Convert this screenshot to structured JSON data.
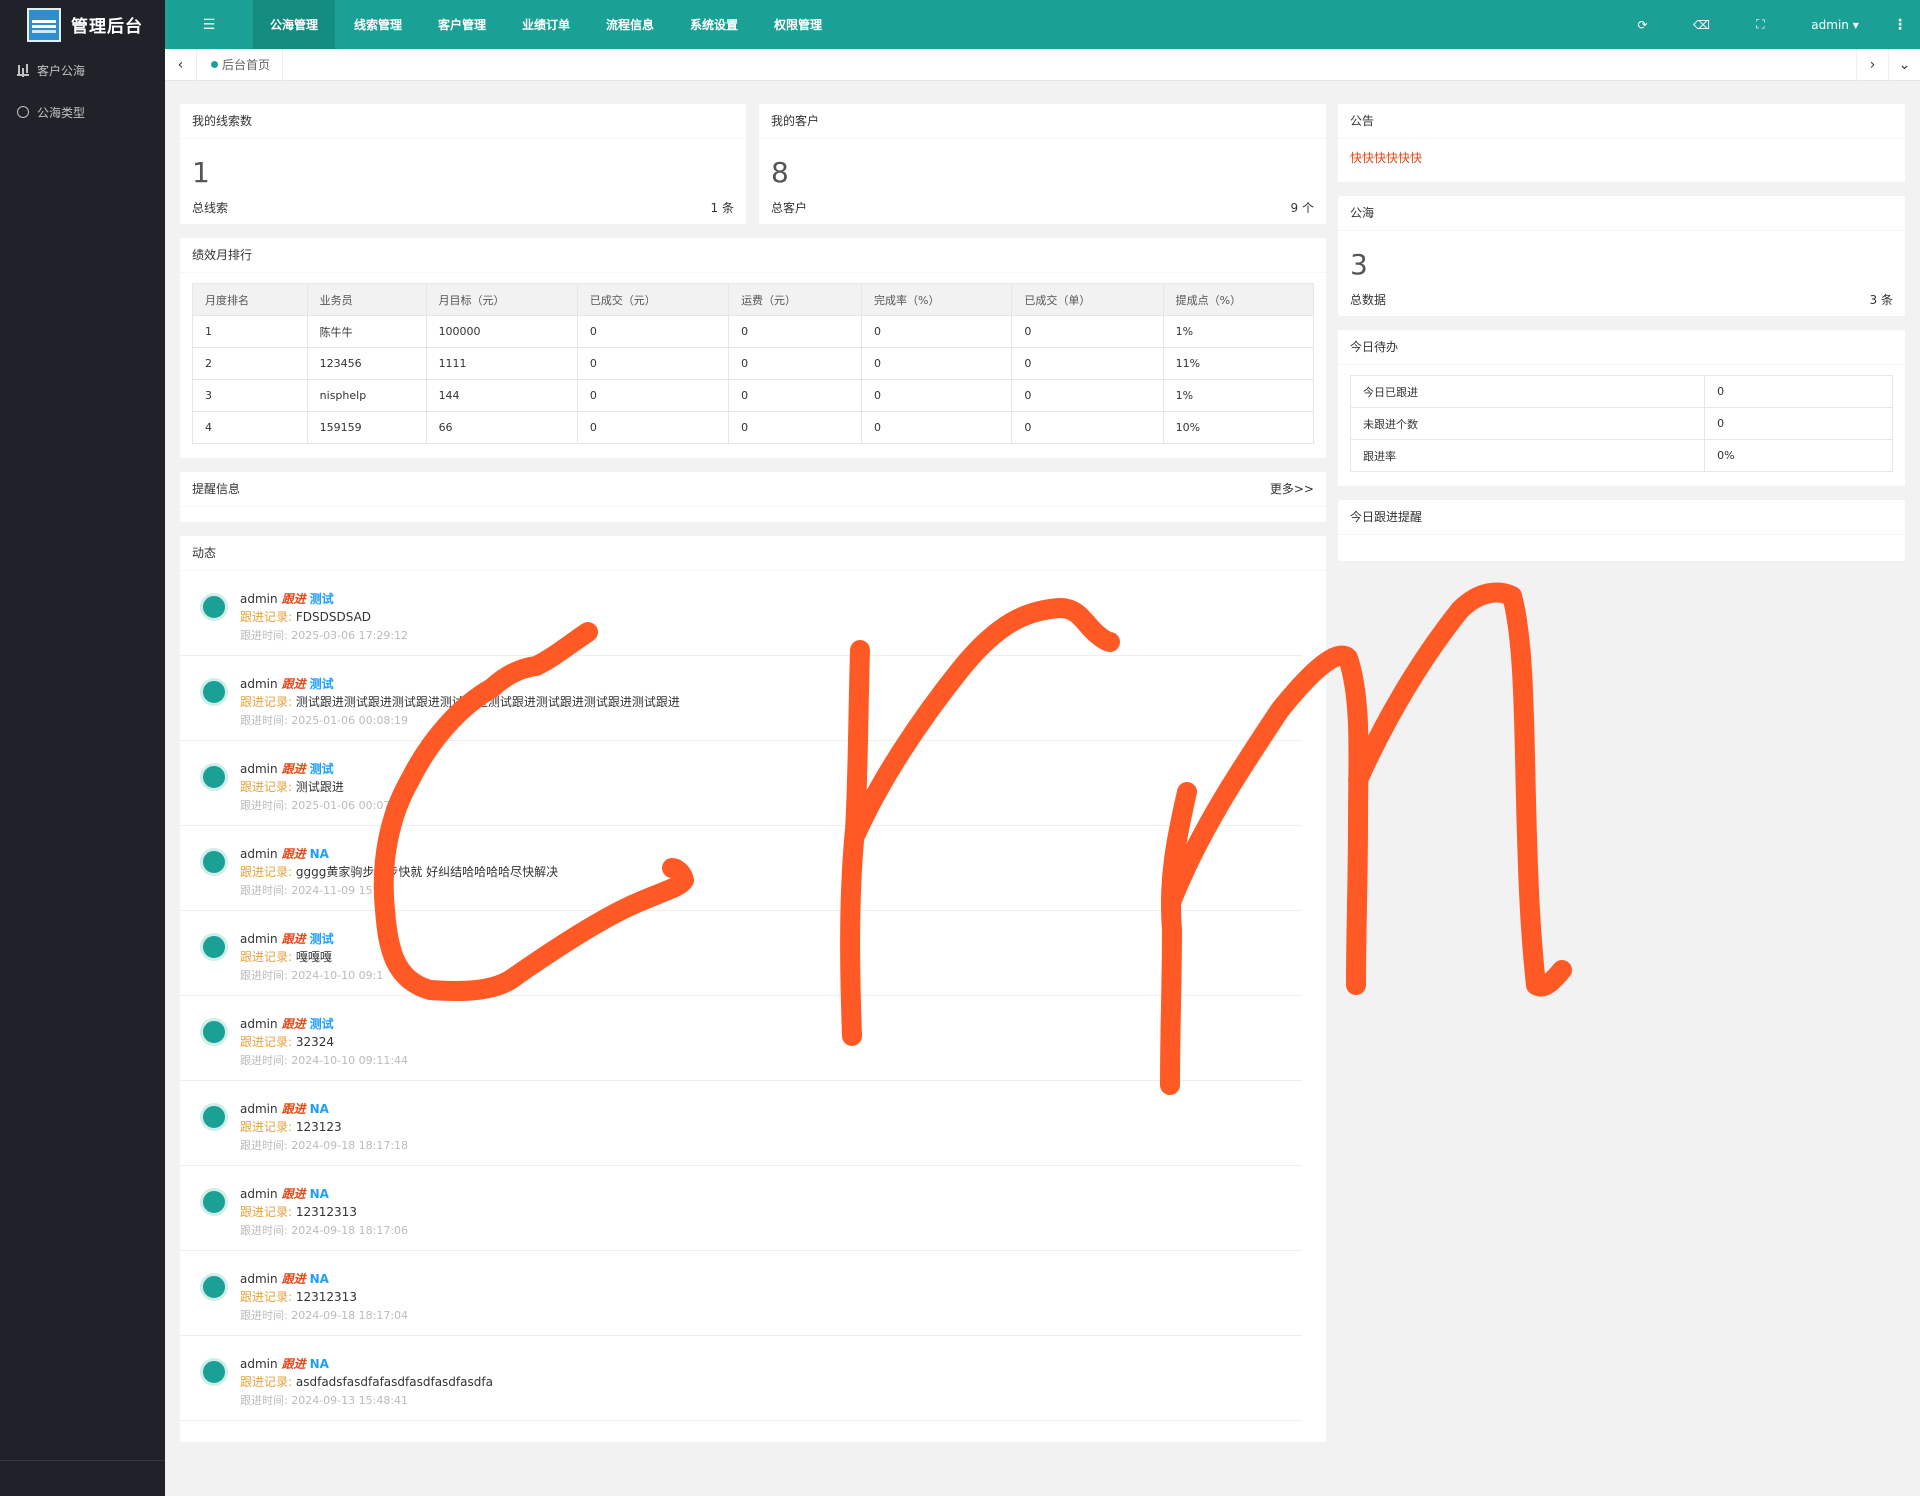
{
  "brand": {
    "title": "管理后台",
    "logo_icon": "logo-icon"
  },
  "sidebar": {
    "items": [
      {
        "label": "客户公海",
        "icon": "bar-chart-icon"
      },
      {
        "label": "公海类型",
        "icon": "circle-icon"
      }
    ]
  },
  "header": {
    "toggle_icon": "☰",
    "nav": [
      "公海管理",
      "线索管理",
      "客户管理",
      "业绩订单",
      "流程信息",
      "系统设置",
      "权限管理"
    ],
    "active_index": 0,
    "refresh_icon": "⟳",
    "clear_icon": "⌫",
    "fullscreen_icon": "⛶",
    "user": "admin ▾",
    "more_icon": "⋮"
  },
  "tabbar": {
    "left_arrow": "‹",
    "home": "后台首页",
    "right_arrow": "›",
    "down_arrow": "⌄"
  },
  "cards": {
    "leads": {
      "title": "我的线索数",
      "value": "1",
      "label": "总线索",
      "count": "1 条"
    },
    "customers": {
      "title": "我的客户",
      "value": "8",
      "label": "总客户",
      "count": "9 个"
    },
    "notice": {
      "title": "公告",
      "text": "快快快快快快"
    },
    "pool": {
      "title": "公海",
      "value": "3",
      "label": "总数据",
      "count": "3 条"
    },
    "todo": {
      "title": "今日待办",
      "rows": [
        {
          "label": "今日已跟进",
          "value": "0"
        },
        {
          "label": "未跟进个数",
          "value": "0"
        },
        {
          "label": "跟进率",
          "value": "0%"
        }
      ]
    },
    "reminder_today": {
      "title": "今日跟进提醒"
    },
    "ranking": {
      "title": "绩效月排行",
      "columns": [
        "月度排名",
        "业务员",
        "月目标（元）",
        "已成交（元）",
        "运费（元）",
        "完成率（%）",
        "已成交（单）",
        "提成点（%）"
      ],
      "rows": [
        [
          "1",
          "陈牛牛",
          "100000",
          "0",
          "0",
          "0",
          "0",
          "1%"
        ],
        [
          "2",
          "123456",
          "1111",
          "0",
          "0",
          "0",
          "0",
          "11%"
        ],
        [
          "3",
          "nisphelp",
          "144",
          "0",
          "0",
          "0",
          "0",
          "1%"
        ],
        [
          "4",
          "159159",
          "66",
          "0",
          "0",
          "0",
          "0",
          "10%"
        ]
      ]
    },
    "reminder": {
      "title": "提醒信息",
      "more": "更多>>"
    },
    "activity": {
      "title": "动态",
      "record_label": "跟进记录:",
      "time_label": "跟进时间:",
      "items": [
        {
          "user": "admin",
          "tag": "跟进",
          "type": "测试",
          "record": "FDSDSDSAD",
          "time": "2025-03-06 17:29:12"
        },
        {
          "user": "admin",
          "tag": "跟进",
          "type": "测试",
          "record": "测试跟进测试跟进测试跟进测试跟进测试跟进测试跟进测试跟进测试跟进",
          "time": "2025-01-06 00:08:19"
        },
        {
          "user": "admin",
          "tag": "跟进",
          "type": "测试",
          "record": "测试跟进",
          "time": "2025-01-06 00:07"
        },
        {
          "user": "admin",
          "tag": "跟进",
          "type": "NA",
          "record": "gggg黄家驹步步步快就 好纠结哈哈哈哈尽快解决",
          "time": "2024-11-09 15:4"
        },
        {
          "user": "admin",
          "tag": "跟进",
          "type": "测试",
          "record": "嘎嘎嘎",
          "time": "2024-10-10 09:1"
        },
        {
          "user": "admin",
          "tag": "跟进",
          "type": "测试",
          "record": "32324",
          "time": "2024-10-10 09:11:44"
        },
        {
          "user": "admin",
          "tag": "跟进",
          "type": "NA",
          "record": "123123",
          "time": "2024-09-18 18:17:18"
        },
        {
          "user": "admin",
          "tag": "跟进",
          "type": "NA",
          "record": "12312313",
          "time": "2024-09-18 18:17:06"
        },
        {
          "user": "admin",
          "tag": "跟进",
          "type": "NA",
          "record": "12312313",
          "time": "2024-09-18 18:17:04"
        },
        {
          "user": "admin",
          "tag": "跟进",
          "type": "NA",
          "record": "asdfadsfasdfafasdfasdfasdfasdfa",
          "time": "2024-09-13 15:48:41"
        }
      ]
    }
  },
  "overlay": {
    "description_icon": "handwritten-crm-scribble",
    "color": "#ff5a26"
  },
  "colors": {
    "accent": "#1aa094",
    "sidebar": "#20222a",
    "alert": "#e64a19"
  }
}
